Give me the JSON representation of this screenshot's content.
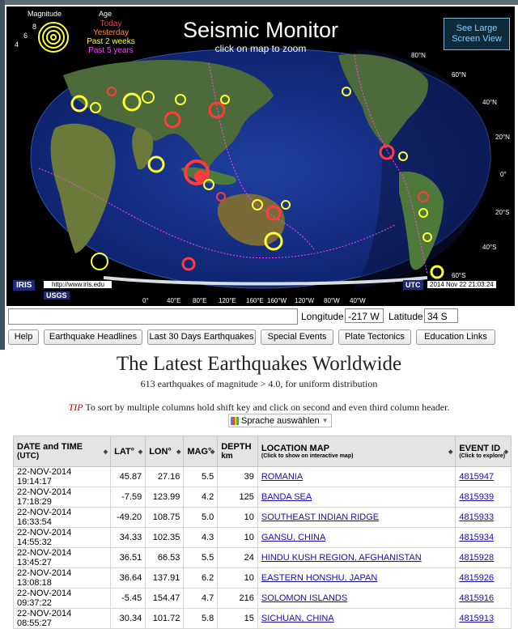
{
  "map": {
    "title": "Seismic Monitor",
    "subtitle": "click on map to zoom",
    "legend": {
      "magnitude_label": "Magnitude",
      "age_label": "Age",
      "mag_values": [
        "8",
        "6",
        "4"
      ],
      "ages": [
        {
          "label": "Today",
          "color": "#ff3b3b"
        },
        {
          "label": "Yesterday",
          "color": "#ff8a3b"
        },
        {
          "label": "Past 2 weeks",
          "color": "#ffff33"
        },
        {
          "label": "Past 5 years",
          "color": "#ff44ff"
        }
      ]
    },
    "large_view_button": "See Large Screen View",
    "latitude_labels": [
      "80°N",
      "60°N",
      "40°N",
      "20°N",
      "0°",
      "20°S",
      "40°S",
      "60°S"
    ],
    "longitude_labels": [
      "0°",
      "40°E",
      "80°E",
      "120°E",
      "160°E",
      "160°W",
      "120°W",
      "80°W",
      "40°W"
    ],
    "iris_logo": "IRIS",
    "iris_url": "http://www.iris.edu",
    "usgs_logo": "USGS",
    "utc_label": "UTC",
    "utc_value": "2014 Nov 22 21:03:24"
  },
  "coords": {
    "longitude_label": "Longitude",
    "longitude_value": "-217 W",
    "latitude_label": "Latitude",
    "latitude_value": "34 S"
  },
  "nav": {
    "buttons": [
      "Help",
      "Earthquake Headlines",
      "Last 30 Days Earthquakes",
      "Special Events",
      "Plate Tectonics",
      "Education Links"
    ]
  },
  "main": {
    "heading": "The Latest Earthquakes Worldwide",
    "subheading": "613 earthquakes of magnitude > 4.0, for uniform distribution",
    "tip_label": "TIP",
    "tip_text": " To sort by multiple columns hold shift key and click on second and even third column header.",
    "translate_label": "Sprache auswählen"
  },
  "table": {
    "headers": {
      "datetime": "DATE and TIME",
      "datetime_sub": "(UTC)",
      "lat": "LAT°",
      "lon": "LON°",
      "mag": "MAG°",
      "depth": "DEPTH",
      "depth_sub": "km",
      "location": "LOCATION MAP",
      "location_sub": "(Click to show on interactive map)",
      "event": "EVENT ID",
      "event_sub": "(Click to explore)"
    },
    "rows": [
      {
        "datetime": "22-NOV-2014 19:14:17",
        "lat": "45.87",
        "lon": "27.16",
        "mag": "5.5",
        "depth": "39",
        "location": "ROMANIA",
        "event": "4815947"
      },
      {
        "datetime": "22-NOV-2014 17:18:29",
        "lat": "-7.59",
        "lon": "123.99",
        "mag": "4.2",
        "depth": "125",
        "location": "BANDA SEA",
        "event": "4815939"
      },
      {
        "datetime": "22-NOV-2014 16:33:54",
        "lat": "-49.20",
        "lon": "108.75",
        "mag": "5.0",
        "depth": "10",
        "location": "SOUTHEAST INDIAN RIDGE",
        "event": "4815933"
      },
      {
        "datetime": "22-NOV-2014 14:55:32",
        "lat": "34.33",
        "lon": "102.35",
        "mag": "4.3",
        "depth": "10",
        "location": "GANSU, CHINA",
        "event": "4815934"
      },
      {
        "datetime": "22-NOV-2014 13:45:27",
        "lat": "36.51",
        "lon": "66.53",
        "mag": "5.5",
        "depth": "24",
        "location": "HINDU KUSH REGION, AFGHANISTAN",
        "event": "4815928"
      },
      {
        "datetime": "22-NOV-2014 13:08:18",
        "lat": "36.64",
        "lon": "137.91",
        "mag": "6.2",
        "depth": "10",
        "location": "EASTERN HONSHU, JAPAN",
        "event": "4815926"
      },
      {
        "datetime": "22-NOV-2014 09:37:22",
        "lat": "-5.45",
        "lon": "154.47",
        "mag": "4.7",
        "depth": "216",
        "location": "SOLOMON ISLANDS",
        "event": "4815916"
      },
      {
        "datetime": "22-NOV-2014 08:55:27",
        "lat": "30.34",
        "lon": "101.72",
        "mag": "5.8",
        "depth": "15",
        "location": "SICHUAN, CHINA",
        "event": "4815913"
      }
    ]
  }
}
